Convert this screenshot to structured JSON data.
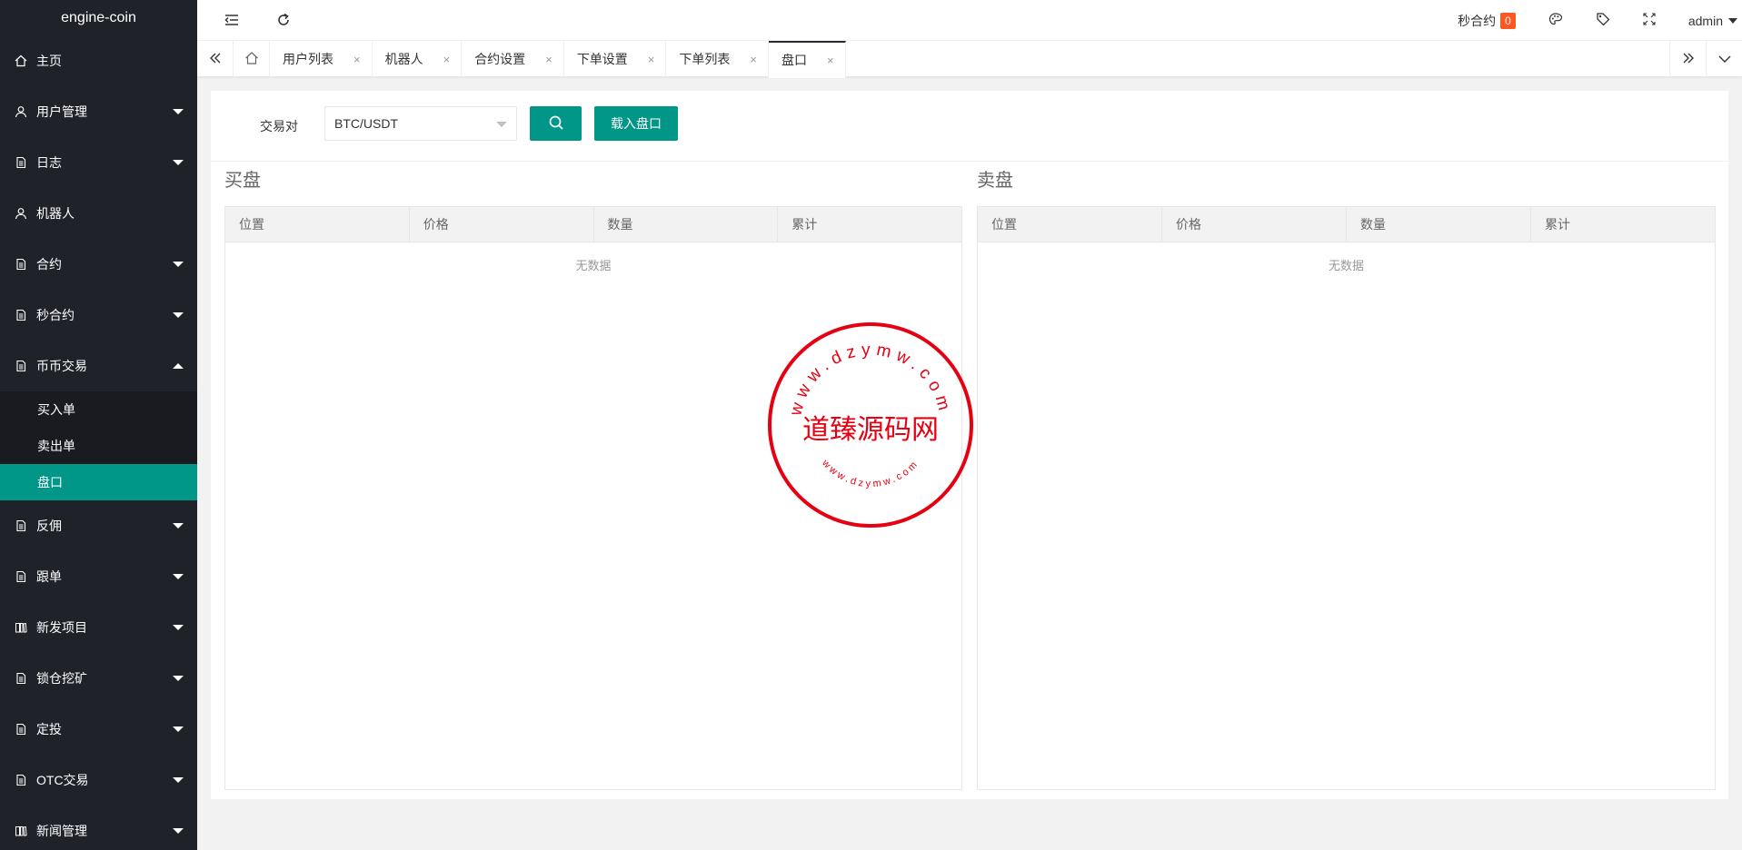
{
  "sidebar": {
    "logo": "engine-coin",
    "items": [
      {
        "label": "主页",
        "icon": "home-icon",
        "caret": "none"
      },
      {
        "label": "用户管理",
        "icon": "user-icon",
        "caret": "down"
      },
      {
        "label": "日志",
        "icon": "file-icon",
        "caret": "down"
      },
      {
        "label": "机器人",
        "icon": "user-icon",
        "caret": "none"
      },
      {
        "label": "合约",
        "icon": "file-icon",
        "caret": "down"
      },
      {
        "label": "秒合约",
        "icon": "file-icon",
        "caret": "down"
      },
      {
        "label": "币币交易",
        "icon": "file-icon",
        "caret": "up"
      }
    ],
    "subitems": [
      {
        "label": "买入单"
      },
      {
        "label": "卖出单"
      },
      {
        "label": "盘口"
      }
    ],
    "items2": [
      {
        "label": "反佣",
        "icon": "file-icon"
      },
      {
        "label": "跟单",
        "icon": "file-icon"
      },
      {
        "label": "新发项目",
        "icon": "book-icon"
      },
      {
        "label": "锁仓挖矿",
        "icon": "file-icon"
      },
      {
        "label": "定投",
        "icon": "file-icon"
      },
      {
        "label": "OTC交易",
        "icon": "file-icon"
      },
      {
        "label": "新闻管理",
        "icon": "book-icon"
      }
    ]
  },
  "header": {
    "miao_label": "秒合约",
    "miao_count": "0",
    "user": "admin"
  },
  "tabs": [
    {
      "label": "用户列表"
    },
    {
      "label": "机器人"
    },
    {
      "label": "合约设置"
    },
    {
      "label": "下单设置"
    },
    {
      "label": "下单列表"
    },
    {
      "label": "盘口"
    }
  ],
  "tab_close_glyph": "×",
  "form": {
    "pair_label": "交易对",
    "pair_value": "BTC/USDT",
    "load_button": "载入盘口"
  },
  "buy": {
    "title": "买盘",
    "columns": [
      "位置",
      "价格",
      "数量",
      "累计"
    ],
    "empty": "无数据"
  },
  "sell": {
    "title": "卖盘",
    "columns": [
      "位置",
      "价格",
      "数量",
      "累计"
    ],
    "empty": "无数据"
  },
  "stamp": {
    "main_text": "道臻源码网",
    "ring_text": "www.dzymw.com"
  },
  "colors": {
    "sidebar_bg": "#20222a",
    "accent": "#009688",
    "badge": "#ff5722",
    "stamp_red": "#e50012"
  }
}
